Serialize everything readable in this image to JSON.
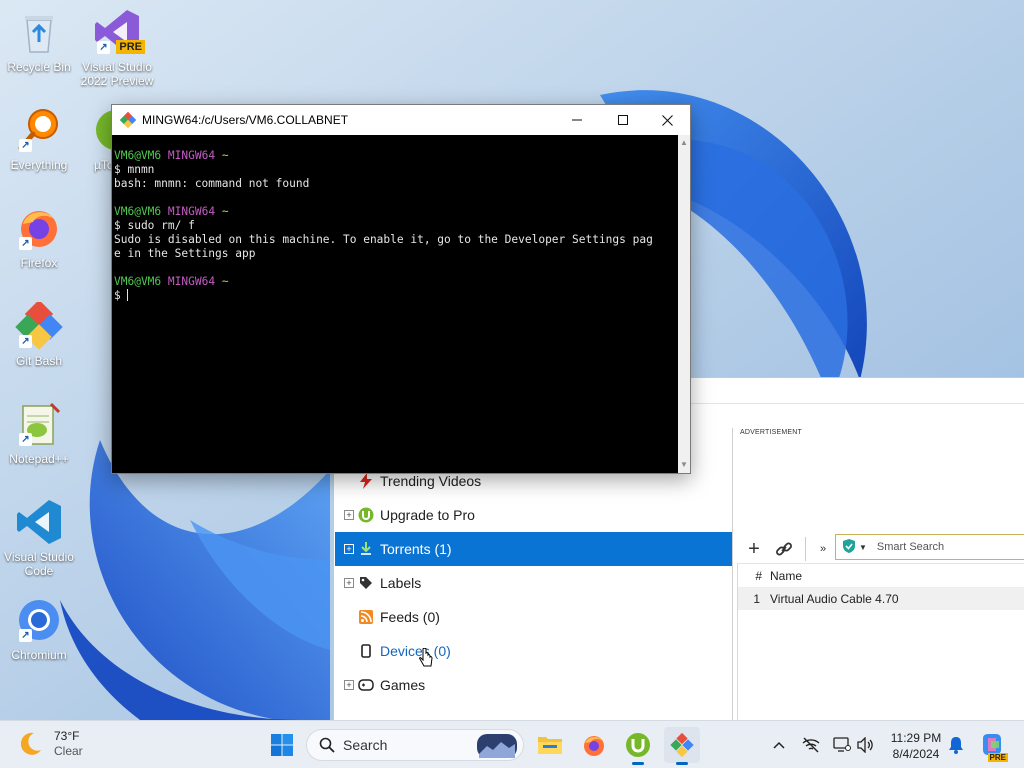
{
  "desktop": {
    "icons": [
      {
        "label": "Recycle Bin",
        "icon": "recycle-bin-icon"
      },
      {
        "label": "Visual Studio 2022 Preview",
        "icon": "visual-studio-preview-icon",
        "badge": "PRE"
      },
      {
        "label": "Everything",
        "icon": "everything-search-icon"
      },
      {
        "label": "µTo",
        "icon": "utorrent-icon"
      },
      {
        "label": "Firefox",
        "icon": "firefox-icon"
      },
      {
        "label": "Git Bash",
        "icon": "git-bash-icon"
      },
      {
        "label": "Notepad++",
        "icon": "notepadpp-icon"
      },
      {
        "label": "Visual Studio Code",
        "icon": "vscode-icon"
      },
      {
        "label": "Chromium",
        "icon": "chromium-icon"
      }
    ]
  },
  "terminal": {
    "title": "MINGW64:/c/Users/VM6.COLLABNET",
    "controls": {
      "minimize": "—",
      "maximize": "☐",
      "close": "✕"
    },
    "lines": {
      "p1_user": "VM6@VM6",
      "p1_env": "MINGW64",
      "p1_path": "~",
      "cmd1": "$ mnmn",
      "out1": "bash: mnmn: command not found",
      "p2_user": "VM6@VM6",
      "p2_env": "MINGW64",
      "p2_path": "~",
      "cmd2": "$ sudo rm/ f",
      "out2a": "Sudo is disabled on this machine. To enable it, go to the Developer Settings pag",
      "out2b": "e in the Settings app",
      "p3_user": "VM6@VM6",
      "p3_env": "MINGW64",
      "p3_path": "~",
      "cmd3": "$ "
    }
  },
  "utorrent": {
    "sidebar": [
      {
        "label": "Trending Videos",
        "icon": "lightning-icon",
        "expandable": false
      },
      {
        "label": "Upgrade to Pro",
        "icon": "utorrent-logo-icon",
        "expandable": true
      },
      {
        "label": "Torrents (1)",
        "icon": "torrents-icon",
        "expandable": true,
        "selected": true
      },
      {
        "label": "Labels",
        "icon": "tag-icon",
        "expandable": true
      },
      {
        "label": "Feeds (0)",
        "icon": "rss-icon",
        "expandable": false
      },
      {
        "label": "Devices (0)",
        "icon": "device-icon",
        "expandable": false,
        "link": true
      },
      {
        "label": "Games",
        "icon": "gamepad-icon",
        "expandable": true
      }
    ],
    "ad_label": "ADVERTISEMENT",
    "search_placeholder": "Smart Search",
    "list": {
      "columns": [
        "#",
        "Name"
      ],
      "rows": [
        {
          "num": "1",
          "name": "Virtual Audio Cable 4.70"
        }
      ]
    }
  },
  "taskbar": {
    "weather": {
      "temp": "73°F",
      "condition": "Clear"
    },
    "search_label": "Search",
    "clock": {
      "time": "11:29 PM",
      "date": "8/4/2024"
    },
    "copilot_badge": "PRE"
  },
  "colors": {
    "selected": "#0a74d4",
    "terminal_bg": "#000000",
    "prompt_green": "#4fc84f",
    "prompt_purple": "#c35cc3"
  }
}
